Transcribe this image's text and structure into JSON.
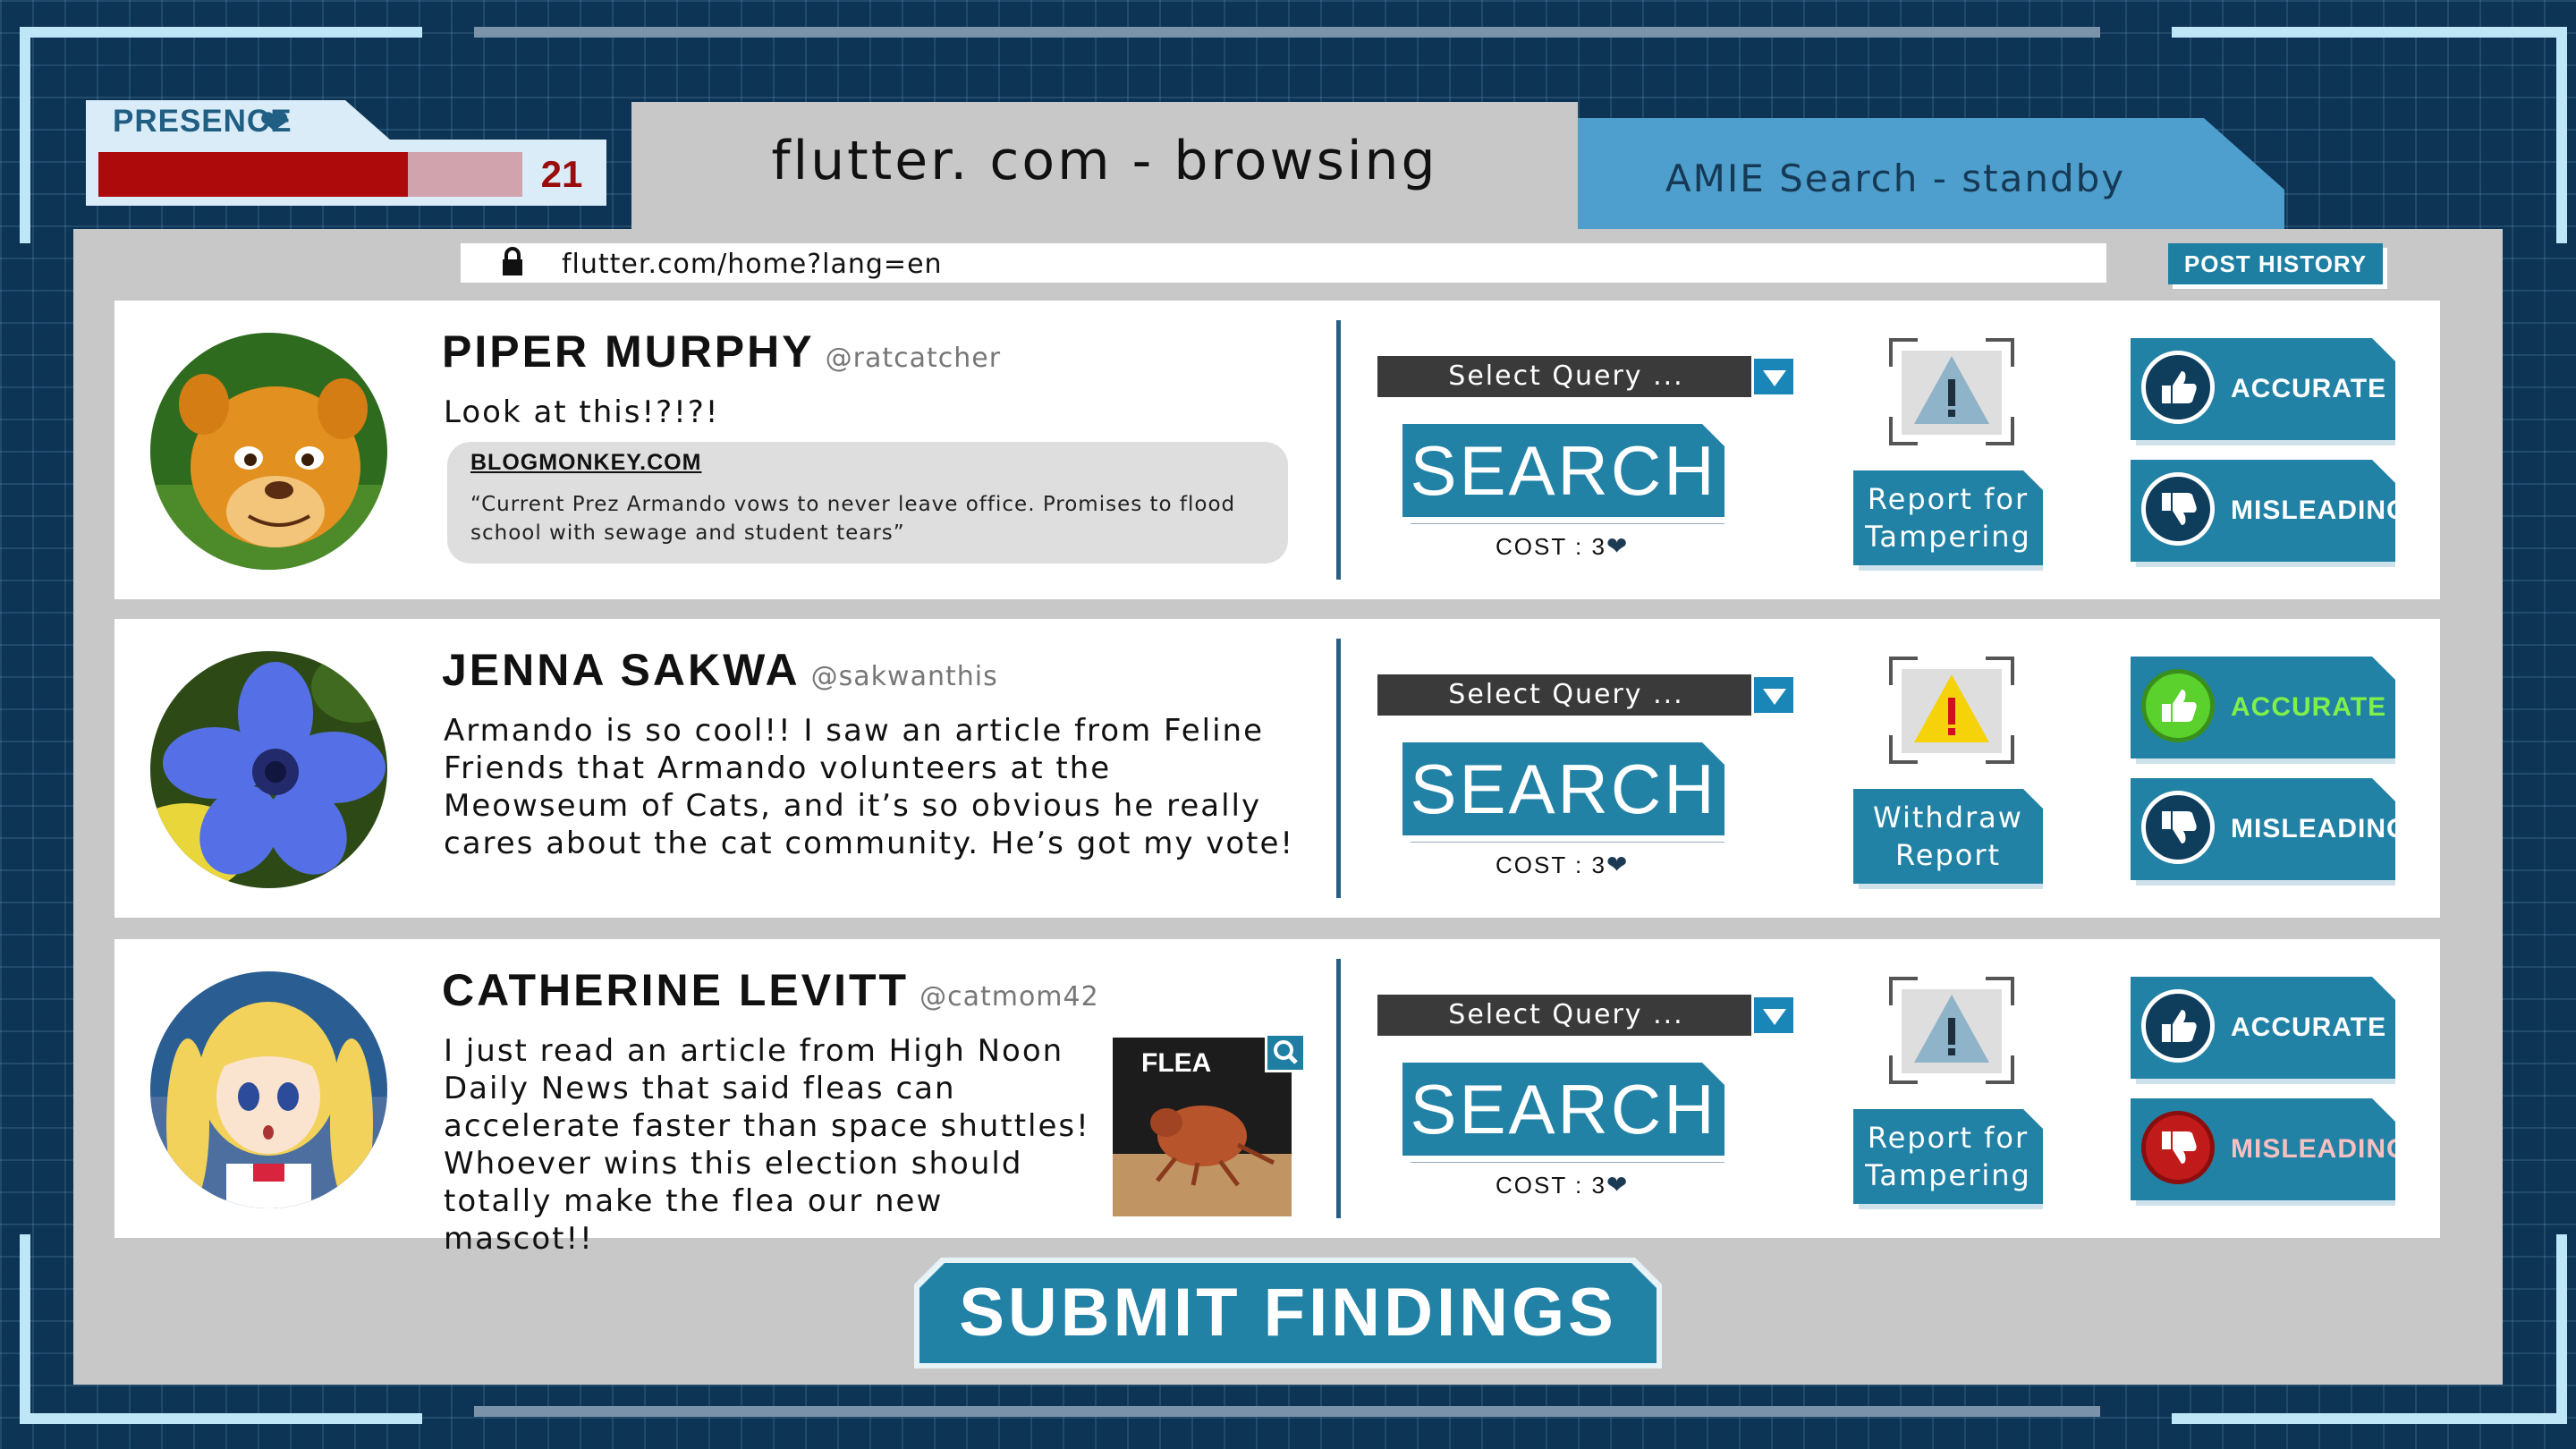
{
  "presence": {
    "label": "PRESENCE",
    "value": "21",
    "fill_fraction": 0.73,
    "icon": "heart-icon"
  },
  "tabs": [
    {
      "label": "flutter. com - browsing",
      "active": true
    },
    {
      "label": "AMIE Search - standby",
      "active": false
    }
  ],
  "browser": {
    "url": "flutter.com/home?lang=en",
    "post_history_label": "POST HISTORY"
  },
  "posts": [
    {
      "name": "PIPER MURPHY",
      "handle": "@ratcatcher",
      "text": "Look at this!?!?!",
      "preview": {
        "source": "BLOGMONKEY.COM",
        "text": "“Current Prez Armando vows to never leave office. Promises to flood school with sewage and student tears”"
      },
      "query_label": "Select Query ...",
      "search_label": "SEARCH",
      "cost_label": "COST :",
      "cost_value": "3",
      "report_label_1": "Report for",
      "report_label_2": "Tampering",
      "report_state": "inactive",
      "accurate_label": "ACCURATE",
      "misleading_label": "MISLEADING",
      "verdict": "none"
    },
    {
      "name": "JENNA SAKWA",
      "handle": "@sakwanthis",
      "text": "Armando is so cool!! I saw an article from Feline Friends that Armando volunteers at the Meowseum of Cats, and it’s so obvious he really cares about the cat community. He’s got my vote!",
      "query_label": "Select Query ...",
      "search_label": "SEARCH",
      "cost_label": "COST :",
      "cost_value": "3",
      "report_label_1": "Withdraw",
      "report_label_2": "Report",
      "report_state": "active",
      "accurate_label": "ACCURATE",
      "misleading_label": "MISLEADING",
      "verdict": "accurate"
    },
    {
      "name": "CATHERINE LEVITT",
      "handle": "@catmom42",
      "text": "I just read an article from High Noon Daily News that said fleas can accelerate faster than space shuttles! Whoever wins this election should totally make the flea our new mascot!!",
      "image_label": "FLEA",
      "query_label": "Select Query ...",
      "search_label": "SEARCH",
      "cost_label": "COST :",
      "cost_value": "3",
      "report_label_1": "Report for",
      "report_label_2": "Tampering",
      "report_state": "inactive",
      "accurate_label": "ACCURATE",
      "misleading_label": "MISLEADING",
      "verdict": "misleading"
    }
  ],
  "submit_label": "SUBMIT FINDINGS",
  "colors": {
    "background": "#0d3454",
    "panel": "#c8c8c8",
    "button": "#2282a6",
    "accurate_selected": "#5ad12c",
    "misleading_selected": "#c11a1a",
    "presence_fill": "#ad0b0b",
    "warning_active": "#f5d20a"
  }
}
